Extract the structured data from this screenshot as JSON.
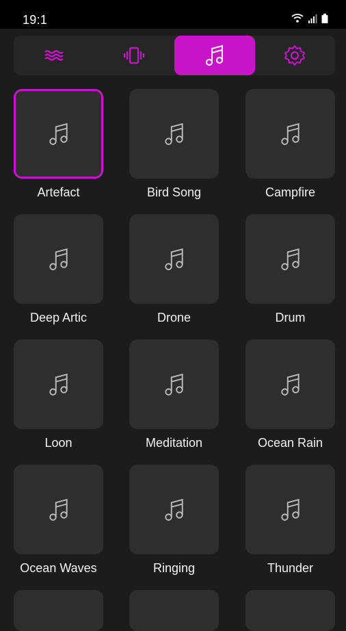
{
  "status_bar": {
    "time": "19:1"
  },
  "tabs": [
    {
      "name": "waves",
      "icon": "waves-icon",
      "active": false
    },
    {
      "name": "vibration",
      "icon": "vibration-icon",
      "active": false
    },
    {
      "name": "music",
      "icon": "music-note-icon",
      "active": true
    },
    {
      "name": "settings",
      "icon": "gear-icon",
      "active": false
    }
  ],
  "sounds": [
    {
      "label": "Artefact",
      "selected": true
    },
    {
      "label": "Bird Song"
    },
    {
      "label": "Campfire"
    },
    {
      "label": "Deep Artic"
    },
    {
      "label": "Drone"
    },
    {
      "label": "Drum"
    },
    {
      "label": "Loon"
    },
    {
      "label": "Meditation"
    },
    {
      "label": "Ocean Rain"
    },
    {
      "label": "Ocean Waves"
    },
    {
      "label": "Ringing"
    },
    {
      "label": "Thunder"
    }
  ],
  "colors": {
    "accent": "#c814c8",
    "background": "#1c1c1c",
    "tile": "#2e2e2e"
  }
}
